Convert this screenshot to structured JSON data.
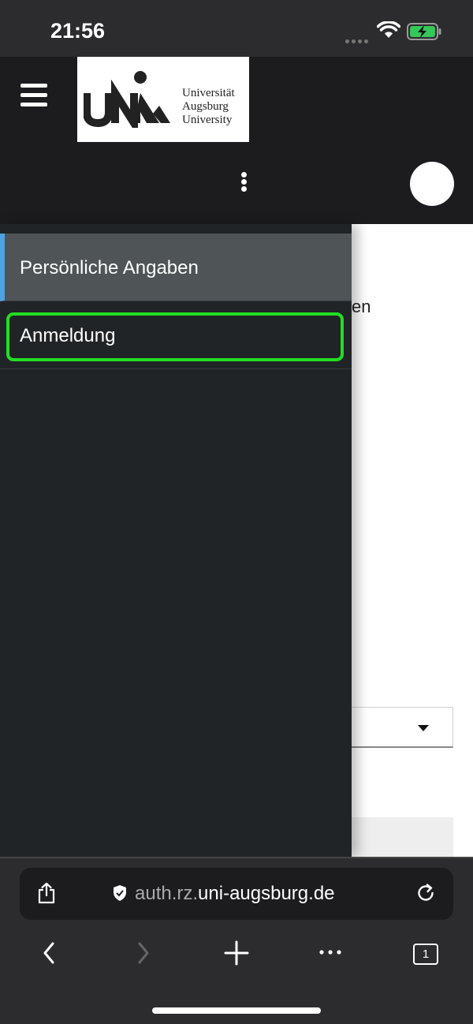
{
  "status_bar": {
    "time": "21:56"
  },
  "header": {
    "logo": {
      "line1": "Universität",
      "line2": "Augsburg",
      "line3": "University"
    },
    "icons": [
      "menu-icon",
      "more-vert-icon",
      "avatar"
    ]
  },
  "drawer": {
    "items": [
      {
        "label": "Persönliche Angaben",
        "active": true
      },
      {
        "label": "Anmeldung",
        "active": false,
        "highlighted": true
      }
    ],
    "accent_color": "#4ea2e0",
    "highlight_color": "#22dd22"
  },
  "content": {
    "partial_text": "en"
  },
  "browser": {
    "url_prefix": "auth.rz.",
    "url_domain": "uni-augsburg.de",
    "tab_count": "1",
    "icons": [
      "share-icon",
      "shield-icon",
      "reload-icon",
      "back-icon",
      "forward-icon",
      "new-tab-icon",
      "more-icon",
      "tabs-icon"
    ]
  }
}
